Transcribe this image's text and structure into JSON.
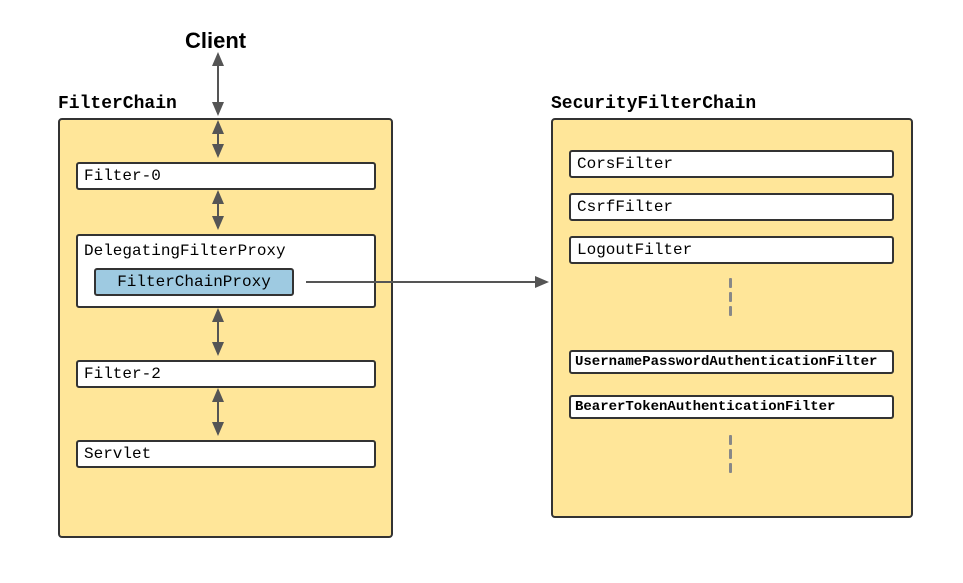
{
  "client": {
    "label": "Client"
  },
  "filterChain": {
    "title": "FilterChain",
    "filter0": "Filter-0",
    "delegatingFilterProxy": "DelegatingFilterProxy",
    "filterChainProxy": "FilterChainProxy",
    "filter2": "Filter-2",
    "servlet": "Servlet"
  },
  "securityFilterChain": {
    "title": "SecurityFilterChain",
    "corsFilter": "CorsFilter",
    "csrfFilter": "CsrfFilter",
    "logoutFilter": "LogoutFilter",
    "usernamePasswordAuthFilter": "UsernamePasswordAuthenticationFilter",
    "bearerTokenAuthFilter": "BearerTokenAuthenticationFilter"
  }
}
